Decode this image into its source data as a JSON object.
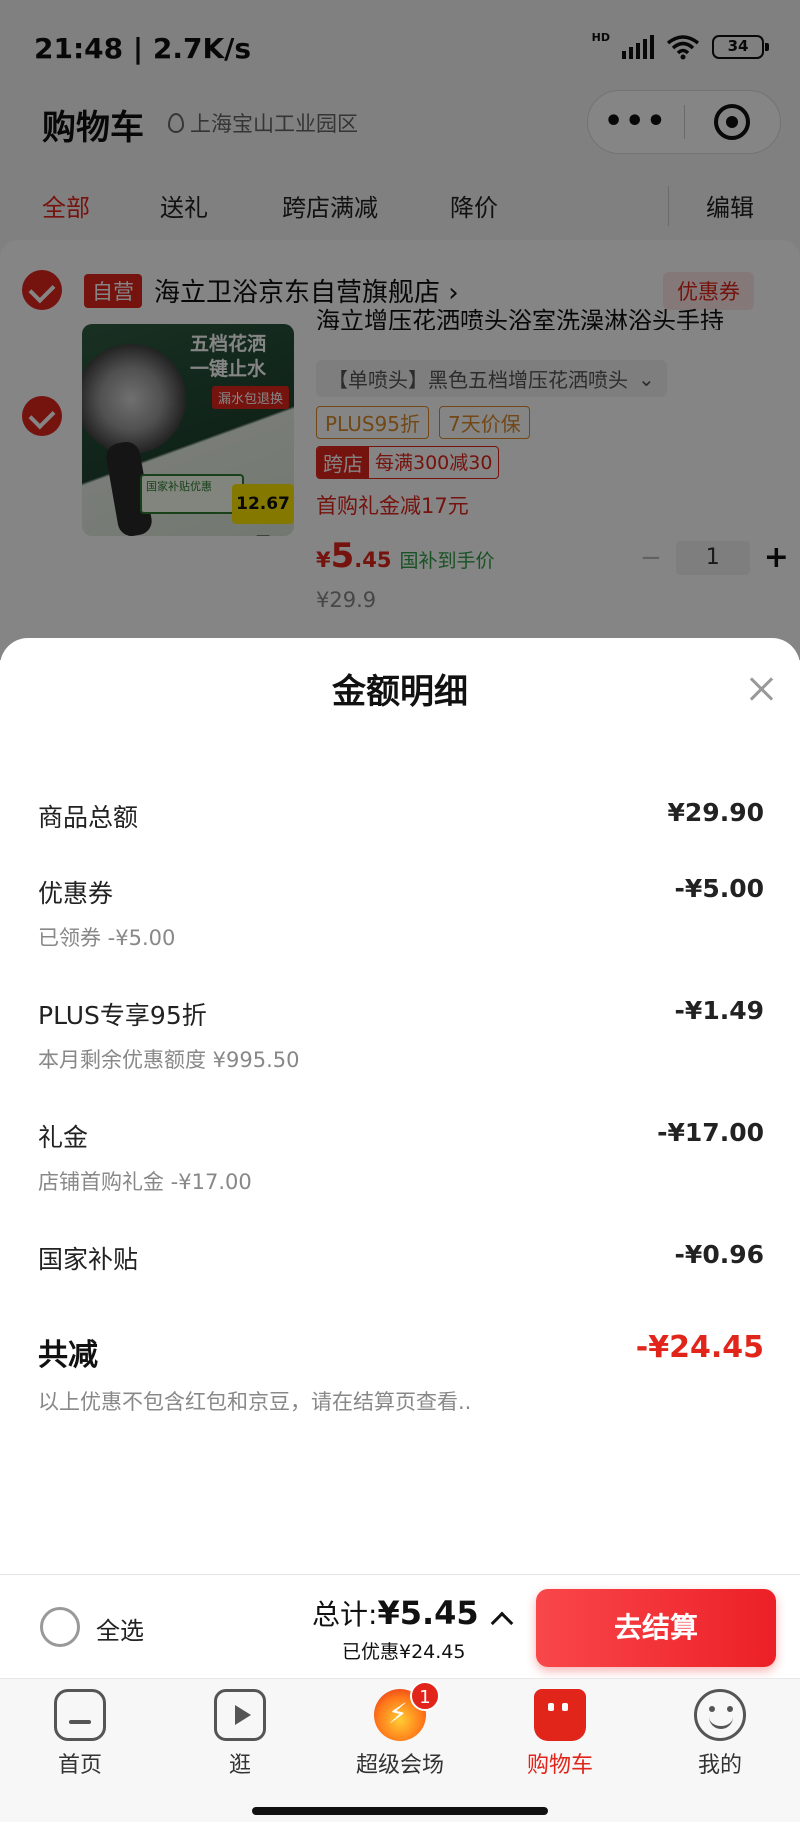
{
  "status_bar": {
    "time": "21:48 | 2.7K/s",
    "signal_label": "HD",
    "wifi_label": "6",
    "battery": "34"
  },
  "header": {
    "title": "购物车",
    "location": "上海宝山工业园区",
    "capsule_more": "•••"
  },
  "filters": {
    "tabs": [
      "全部",
      "送礼",
      "跨店满减",
      "降价"
    ],
    "edit": "编辑"
  },
  "store": {
    "badge": "自营",
    "name": "海立卫浴京东自营旗舰店 ›",
    "coupon_button": "优惠券"
  },
  "product": {
    "image_text_1": "五档花洒",
    "image_text_2": "一键止水",
    "image_tag": "漏水包退换",
    "image_subsidy": "国家补贴优惠",
    "image_price": "12.67元",
    "title": "海立增压花洒喷头浴室洗澡淋浴头手持",
    "spec": "【单喷头】黑色五档增压花洒喷头",
    "tags": [
      "PLUS95折",
      "7天价保"
    ],
    "promo_badge": "跨店",
    "promo_text": "每满300减30",
    "gift_text": "首购礼金减17元",
    "price_symbol": "¥",
    "price_int": "5",
    "price_dec": ".45",
    "price_note": "国补到手价",
    "original_price": "¥29.9",
    "quantity": "1",
    "minus": "−",
    "plus": "+"
  },
  "sheet": {
    "title": "金额明细",
    "rows": [
      {
        "label": "商品总额",
        "value": "¥29.90",
        "sub": ""
      },
      {
        "label": "优惠券",
        "value": "-¥5.00",
        "sub": "已领券 -¥5.00"
      },
      {
        "label": "PLUS专享95折",
        "value": "-¥1.49",
        "sub": "本月剩余优惠额度 ¥995.50"
      },
      {
        "label": "礼金",
        "value": "-¥17.00",
        "sub": "店铺首购礼金 -¥17.00"
      },
      {
        "label": "国家补贴",
        "value": "-¥0.96",
        "sub": ""
      }
    ],
    "total_label": "共减",
    "total_value": "-¥24.45",
    "note": "以上优惠不包含红包和京豆，请在结算页查看.."
  },
  "checkout": {
    "select_all": "全选",
    "total_prefix": "总计:",
    "total_value": "¥5.45",
    "saved": "已优惠¥24.45",
    "button": "去结算"
  },
  "tabbar": {
    "items": [
      {
        "label": "首页",
        "icon": "home-icon"
      },
      {
        "label": "逛",
        "icon": "video-icon"
      },
      {
        "label": "超级会场",
        "icon": "fire-icon",
        "badge": "1"
      },
      {
        "label": "购物车",
        "icon": "cart-icon"
      },
      {
        "label": "我的",
        "icon": "smile-icon"
      }
    ]
  },
  "colors": {
    "accent": "#e1251b",
    "green": "#2e9e48",
    "orange": "#d98a2b"
  }
}
